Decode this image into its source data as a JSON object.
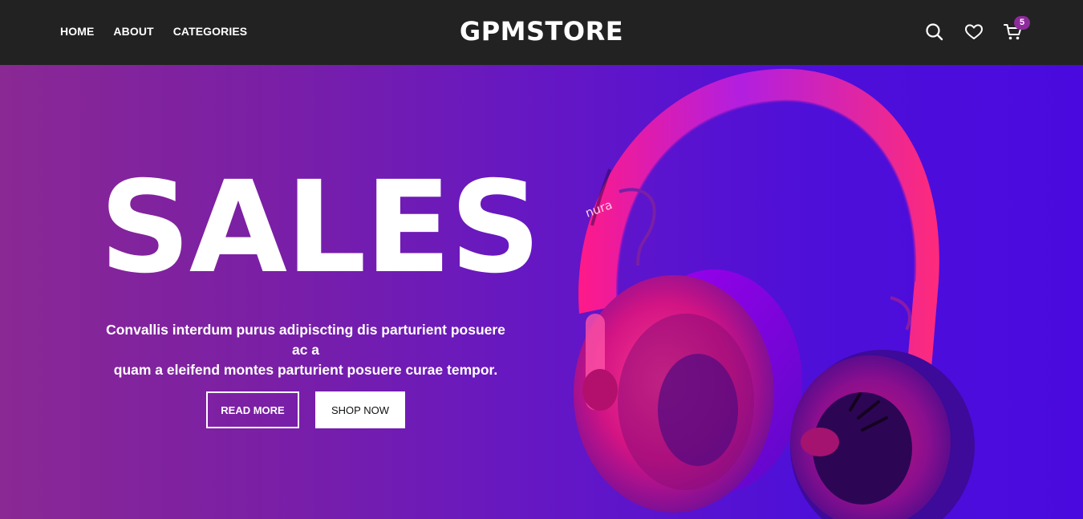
{
  "header": {
    "brand": "GPMSTORE",
    "nav": [
      {
        "label": "HOME"
      },
      {
        "label": "ABOUT"
      },
      {
        "label": "CATEGORIES"
      }
    ],
    "icons": {
      "search": "search-icon",
      "wishlist": "heart-icon",
      "cart": "cart-icon"
    },
    "cart_count": "5"
  },
  "hero": {
    "title": "SALES",
    "subtitle_line1": "Convallis interdum purus adipiscting dis parturient posuere ac a",
    "subtitle_line2": "quam a eleifend montes parturient posuere curae tempor.",
    "read_more": "READ MORE",
    "shop_now": "SHOP NOW",
    "image": {
      "brand_mark": "nura"
    }
  },
  "colors": {
    "header_bg": "#222222",
    "hero_gradient_start": "#8a2894",
    "hero_gradient_end": "#4a0adf",
    "badge": "#8e2a9c",
    "headphone_pink": "#ff1e8c",
    "headphone_violet": "#9b1ff0"
  }
}
